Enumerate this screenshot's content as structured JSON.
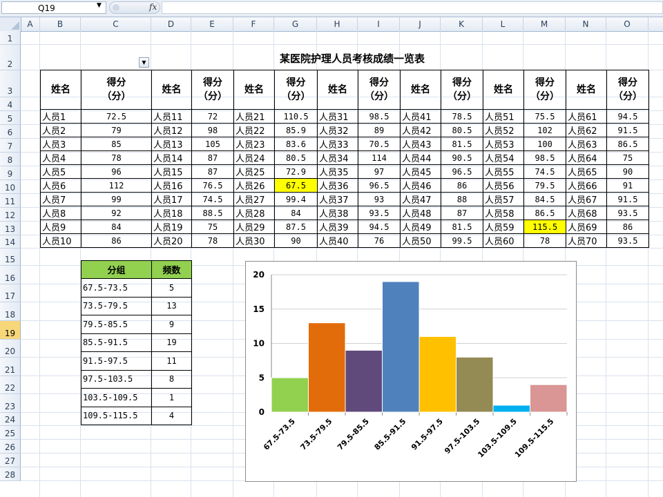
{
  "formula_bar": {
    "name_box": "Q19",
    "fx_label": "fx",
    "formula": ""
  },
  "columns": [
    "A",
    "B",
    "C",
    "D",
    "E",
    "F",
    "G",
    "H",
    "I",
    "J",
    "K",
    "L",
    "M",
    "N",
    "O"
  ],
  "rows": [
    "1",
    "2",
    "3",
    "4",
    "5",
    "6",
    "7",
    "8",
    "9",
    "10",
    "11",
    "12",
    "13",
    "14",
    "15",
    "16",
    "17",
    "18",
    "19",
    "20",
    "21",
    "22",
    "23",
    "24",
    "25",
    "26",
    "27",
    "28"
  ],
  "selected_row": "19",
  "sheet": {
    "title": "某医院护理人员考核成绩一览表",
    "header_name": "姓名",
    "header_score_line1": "得分",
    "header_score_line2": "（分）",
    "table_rows": [
      [
        [
          "人员1",
          "72.5"
        ],
        [
          "人员11",
          "72"
        ],
        [
          "人员21",
          "110.5"
        ],
        [
          "人员31",
          "98.5"
        ],
        [
          "人员41",
          "78.5"
        ],
        [
          "人员51",
          "75.5"
        ],
        [
          "人员61",
          "94.5"
        ]
      ],
      [
        [
          "人员2",
          "79"
        ],
        [
          "人员12",
          "98"
        ],
        [
          "人员22",
          "85.9"
        ],
        [
          "人员32",
          "89"
        ],
        [
          "人员42",
          "80.5"
        ],
        [
          "人员52",
          "102"
        ],
        [
          "人员62",
          "91.5"
        ]
      ],
      [
        [
          "人员3",
          "85"
        ],
        [
          "人员13",
          "105"
        ],
        [
          "人员23",
          "83.6"
        ],
        [
          "人员33",
          "70.5"
        ],
        [
          "人员43",
          "81.5"
        ],
        [
          "人员53",
          "100"
        ],
        [
          "人员63",
          "86.5"
        ]
      ],
      [
        [
          "人员4",
          "78"
        ],
        [
          "人员14",
          "87"
        ],
        [
          "人员24",
          "80.5"
        ],
        [
          "人员34",
          "114"
        ],
        [
          "人员44",
          "90.5"
        ],
        [
          "人员54",
          "98.5"
        ],
        [
          "人员64",
          "75"
        ]
      ],
      [
        [
          "人员5",
          "96"
        ],
        [
          "人员15",
          "87"
        ],
        [
          "人员25",
          "72.9"
        ],
        [
          "人员35",
          "97"
        ],
        [
          "人员45",
          "96.5"
        ],
        [
          "人员55",
          "74.5"
        ],
        [
          "人员65",
          "90"
        ]
      ],
      [
        [
          "人员6",
          "112"
        ],
        [
          "人员16",
          "76.5"
        ],
        [
          "人员26",
          "67.5"
        ],
        [
          "人员36",
          "96.5"
        ],
        [
          "人员46",
          "86"
        ],
        [
          "人员56",
          "79.5"
        ],
        [
          "人员66",
          "91"
        ]
      ],
      [
        [
          "人员7",
          "99"
        ],
        [
          "人员17",
          "74.5"
        ],
        [
          "人员27",
          "99.4"
        ],
        [
          "人员37",
          "93"
        ],
        [
          "人员47",
          "88"
        ],
        [
          "人员57",
          "84.5"
        ],
        [
          "人员67",
          "91.5"
        ]
      ],
      [
        [
          "人员8",
          "92"
        ],
        [
          "人员18",
          "88.5"
        ],
        [
          "人员28",
          "84"
        ],
        [
          "人员38",
          "93.5"
        ],
        [
          "人员48",
          "87"
        ],
        [
          "人员58",
          "86.5"
        ],
        [
          "人员68",
          "93.5"
        ]
      ],
      [
        [
          "人员9",
          "84"
        ],
        [
          "人员19",
          "75"
        ],
        [
          "人员29",
          "87.5"
        ],
        [
          "人员39",
          "94.5"
        ],
        [
          "人员49",
          "81.5"
        ],
        [
          "人员59",
          "115.5"
        ],
        [
          "人员69",
          "86"
        ]
      ],
      [
        [
          "人员10",
          "86"
        ],
        [
          "人员20",
          "78"
        ],
        [
          "人员30",
          "90"
        ],
        [
          "人员40",
          "76"
        ],
        [
          "人员50",
          "99.5"
        ],
        [
          "人员60",
          "78"
        ],
        [
          "人员70",
          "93.5"
        ]
      ]
    ],
    "highlighted_cells": [
      "人员26",
      "人员59"
    ],
    "highlight_color": "#ffff00"
  },
  "frequency_table": {
    "header_group": "分组",
    "header_count": "频数",
    "header_color": "#92d050",
    "rows": [
      [
        "67.5-73.5",
        "5"
      ],
      [
        "73.5-79.5",
        "13"
      ],
      [
        "79.5-85.5",
        "9"
      ],
      [
        "85.5-91.5",
        "19"
      ],
      [
        "91.5-97.5",
        "11"
      ],
      [
        "97.5-103.5",
        "8"
      ],
      [
        "103.5-109.5",
        "1"
      ],
      [
        "109.5-115.5",
        "4"
      ]
    ]
  },
  "chart_data": {
    "type": "bar",
    "categories": [
      "67.5-73.5",
      "73.5-79.5",
      "79.5-85.5",
      "85.5-91.5",
      "91.5-97.5",
      "97.5-103.5",
      "103.5-109.5",
      "109.5-115.5"
    ],
    "values": [
      5,
      13,
      9,
      19,
      11,
      8,
      1,
      4
    ],
    "colors": [
      "#92d050",
      "#e36c0a",
      "#604a7b",
      "#4f81bd",
      "#ffc000",
      "#948a54",
      "#00b0f0",
      "#d99694"
    ],
    "ylim": [
      0,
      20
    ],
    "yticks": [
      0,
      5,
      10,
      15,
      20
    ],
    "grid": true,
    "legend": "none",
    "title": "",
    "xlabel": "",
    "ylabel": ""
  }
}
